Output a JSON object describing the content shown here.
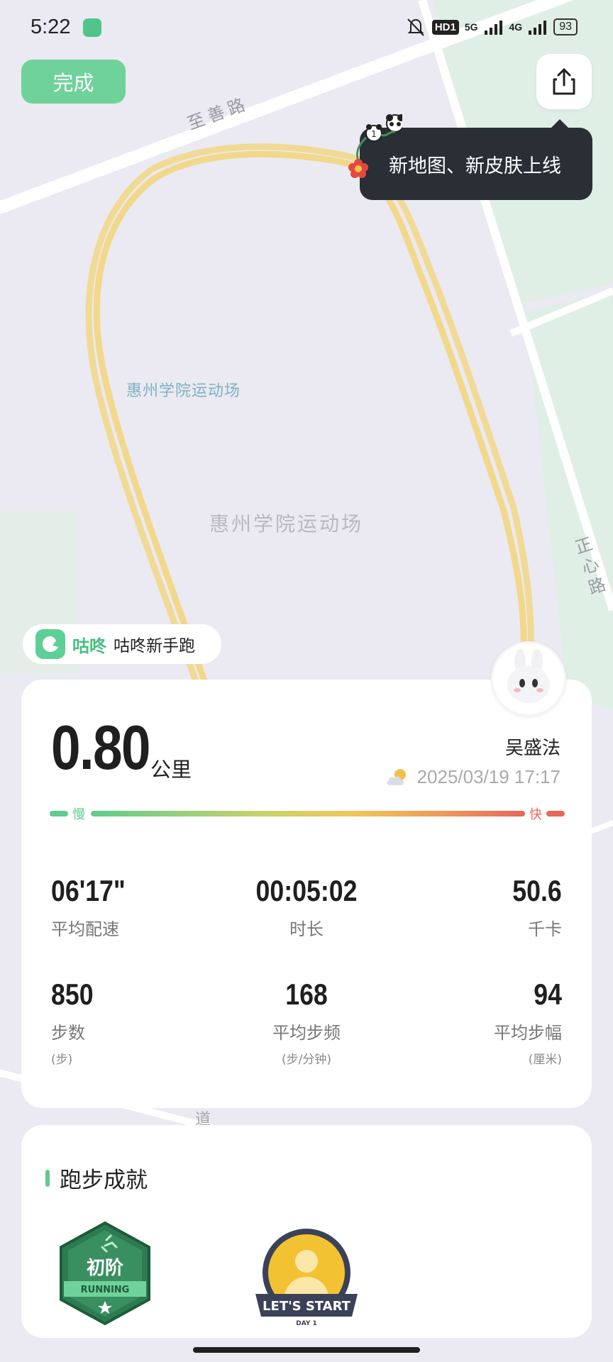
{
  "status_bar": {
    "time": "5:22",
    "hd": "HD1",
    "net1": "5G",
    "net2": "4G",
    "battery": "93"
  },
  "top": {
    "done_label": "完成"
  },
  "tooltip": {
    "text": "新地图、新皮肤上线",
    "deco_number": "1"
  },
  "map": {
    "road_top": "至善路",
    "road_right": "正心路",
    "road_bottom": "道",
    "venue_label_small": "惠州学院运动场",
    "venue_label_large": "惠州学院运动场",
    "route_color": "#f2d88a"
  },
  "brand": {
    "name": "咕咚",
    "subtitle": "咕咚新手跑"
  },
  "summary": {
    "distance": "0.80",
    "distance_unit": "公里",
    "user_name": "吴盛法",
    "datetime": "2025/03/19 17:17",
    "pace_slow_label": "慢",
    "pace_fast_label": "快"
  },
  "stats": [
    {
      "value": "06'17\"",
      "label": "平均配速",
      "unit": ""
    },
    {
      "value": "00:05:02",
      "label": "时长",
      "unit": ""
    },
    {
      "value": "50.6",
      "label": "千卡",
      "unit": ""
    },
    {
      "value": "850",
      "label": "步数",
      "unit": "(步)"
    },
    {
      "value": "168",
      "label": "平均步频",
      "unit": "(步/分钟)"
    },
    {
      "value": "94",
      "label": "平均步幅",
      "unit": "(厘米)"
    }
  ],
  "achievements": {
    "title": "跑步成就",
    "badge1": {
      "title": "初阶",
      "ribbon": "RUNNING"
    },
    "badge2": {
      "title": "LET'S START",
      "sub": "DAY 1"
    }
  },
  "colors": {
    "accent": "#5fcc8c",
    "done_button": "#6fd29a",
    "tooltip_bg": "#2a2f36",
    "fast": "#e8665a"
  }
}
